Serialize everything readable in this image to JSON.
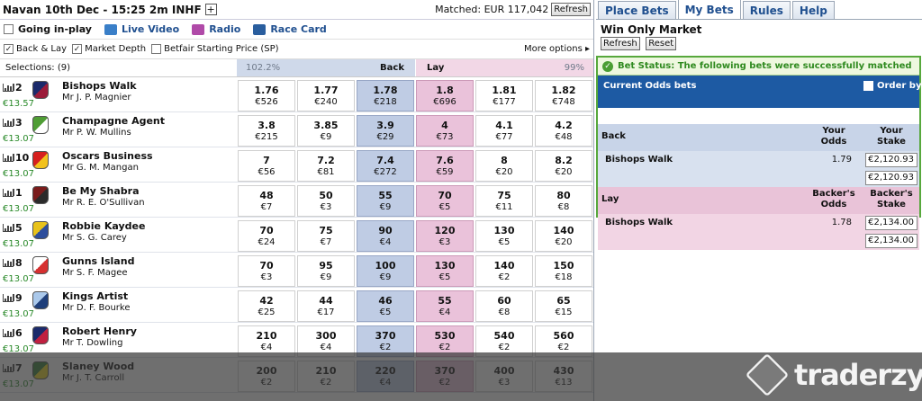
{
  "header": {
    "event_title": "Navan 10th Dec - 15:25 2m INHF",
    "plus": "+",
    "matched": "Matched: EUR 117,042",
    "refresh": "Refresh"
  },
  "links": {
    "going_in_play": "Going in-play",
    "live_video": "Live Video",
    "radio": "Radio",
    "race_card": "Race Card"
  },
  "options": {
    "back_lay": "Back & Lay",
    "market_depth": "Market Depth",
    "bsp": "Betfair Starting Price (SP)",
    "more_options": "More options ▸"
  },
  "selections": {
    "label": "Selections:  (9)",
    "back_pct": "102.2%",
    "back_label": "Back",
    "lay_label": "Lay",
    "lay_pct": "99%"
  },
  "runners": [
    {
      "num": "2",
      "name": "Bishops Walk",
      "jockey": "Mr J. P. Magnier",
      "pl": "€13.57",
      "silk": [
        "#1b2a6b",
        "#9c1c3a"
      ],
      "prices": [
        [
          "1.76",
          "€526"
        ],
        [
          "1.77",
          "€240"
        ],
        [
          "1.78",
          "€218"
        ],
        [
          "1.8",
          "€696"
        ],
        [
          "1.81",
          "€177"
        ],
        [
          "1.82",
          "€748"
        ]
      ]
    },
    {
      "num": "3",
      "name": "Champagne Agent",
      "jockey": "Mr P. W. Mullins",
      "pl": "€13.07",
      "silk": [
        "#4f9d35",
        "#ffffff"
      ],
      "prices": [
        [
          "3.8",
          "€215"
        ],
        [
          "3.85",
          "€9"
        ],
        [
          "3.9",
          "€29"
        ],
        [
          "4",
          "€73"
        ],
        [
          "4.1",
          "€77"
        ],
        [
          "4.2",
          "€48"
        ]
      ]
    },
    {
      "num": "10",
      "name": "Oscars Business",
      "jockey": "Mr G. M. Mangan",
      "pl": "€13.07",
      "silk": [
        "#d6201e",
        "#f2c21c"
      ],
      "prices": [
        [
          "7",
          "€56"
        ],
        [
          "7.2",
          "€81"
        ],
        [
          "7.4",
          "€272"
        ],
        [
          "7.6",
          "€59"
        ],
        [
          "8",
          "€20"
        ],
        [
          "8.2",
          "€20"
        ]
      ]
    },
    {
      "num": "1",
      "name": "Be My Shabra",
      "jockey": "Mr R. E. O'Sullivan",
      "pl": "€13.07",
      "silk": [
        "#7a1c1c",
        "#2b2b2b"
      ],
      "prices": [
        [
          "48",
          "€7"
        ],
        [
          "50",
          "€3"
        ],
        [
          "55",
          "€9"
        ],
        [
          "70",
          "€5"
        ],
        [
          "75",
          "€11"
        ],
        [
          "80",
          "€8"
        ]
      ]
    },
    {
      "num": "5",
      "name": "Robbie Kaydee",
      "jockey": "Mr S. G. Carey",
      "pl": "€13.07",
      "silk": [
        "#e8c21a",
        "#2d4d9c"
      ],
      "prices": [
        [
          "70",
          "€24"
        ],
        [
          "75",
          "€7"
        ],
        [
          "90",
          "€4"
        ],
        [
          "120",
          "€3"
        ],
        [
          "130",
          "€5"
        ],
        [
          "140",
          "€20"
        ]
      ]
    },
    {
      "num": "8",
      "name": "Gunns Island",
      "jockey": "Mr S. F. Magee",
      "pl": "€13.07",
      "silk": [
        "#ffffff",
        "#d63030"
      ],
      "prices": [
        [
          "70",
          "€3"
        ],
        [
          "95",
          "€9"
        ],
        [
          "100",
          "€9"
        ],
        [
          "130",
          "€5"
        ],
        [
          "140",
          "€2"
        ],
        [
          "150",
          "€18"
        ]
      ]
    },
    {
      "num": "9",
      "name": "Kings Artist",
      "jockey": "Mr D. F. Bourke",
      "pl": "€13.07",
      "silk": [
        "#aac8ea",
        "#1f3f7a"
      ],
      "prices": [
        [
          "42",
          "€25"
        ],
        [
          "44",
          "€17"
        ],
        [
          "46",
          "€5"
        ],
        [
          "55",
          "€4"
        ],
        [
          "60",
          "€8"
        ],
        [
          "65",
          "€15"
        ]
      ]
    },
    {
      "num": "6",
      "name": "Robert Henry",
      "jockey": "Mr T. Dowling",
      "pl": "€13.07",
      "silk": [
        "#1b2a6b",
        "#c02040"
      ],
      "prices": [
        [
          "210",
          "€4"
        ],
        [
          "300",
          "€4"
        ],
        [
          "370",
          "€2"
        ],
        [
          "530",
          "€2"
        ],
        [
          "540",
          "€2"
        ],
        [
          "560",
          "€2"
        ]
      ]
    },
    {
      "num": "7",
      "name": "Slaney Wood",
      "jockey": "Mr J. T. Carroll",
      "pl": "€13.07",
      "silk": [
        "#2f7a2f",
        "#e8d21a"
      ],
      "prices": [
        [
          "200",
          "€2"
        ],
        [
          "210",
          "€2"
        ],
        [
          "220",
          "€4"
        ],
        [
          "370",
          "€2"
        ],
        [
          "400",
          "€3"
        ],
        [
          "430",
          "€13"
        ]
      ]
    }
  ],
  "right": {
    "tabs": [
      "Place Bets",
      "My Bets",
      "Rules",
      "Help"
    ],
    "market_title": "Win Only Market",
    "refresh": "Refresh",
    "reset": "Reset",
    "status": "Bet Status: The following bets were successfully matched",
    "current_odds": "Current Odds bets",
    "order_by": "Order by M",
    "back": {
      "label": "Back",
      "col1": "Your Odds",
      "col2": "Your Stake",
      "runner": "Bishops Walk",
      "odds": "1.79",
      "stake": "€2,120.93",
      "total": "€2,120.93"
    },
    "lay": {
      "label": "Lay",
      "col1": "Backer's Odds",
      "col2": "Backer's Stake",
      "runner": "Bishops Walk",
      "odds": "1.78",
      "stake": "€2,134.00",
      "total": "€2,134.00"
    }
  },
  "watermark": "traderzy.pl",
  "colors": {
    "back": "#bfcce4",
    "lay": "#eac2da",
    "accent": "#1d5aa3",
    "success": "#4a9e33"
  }
}
